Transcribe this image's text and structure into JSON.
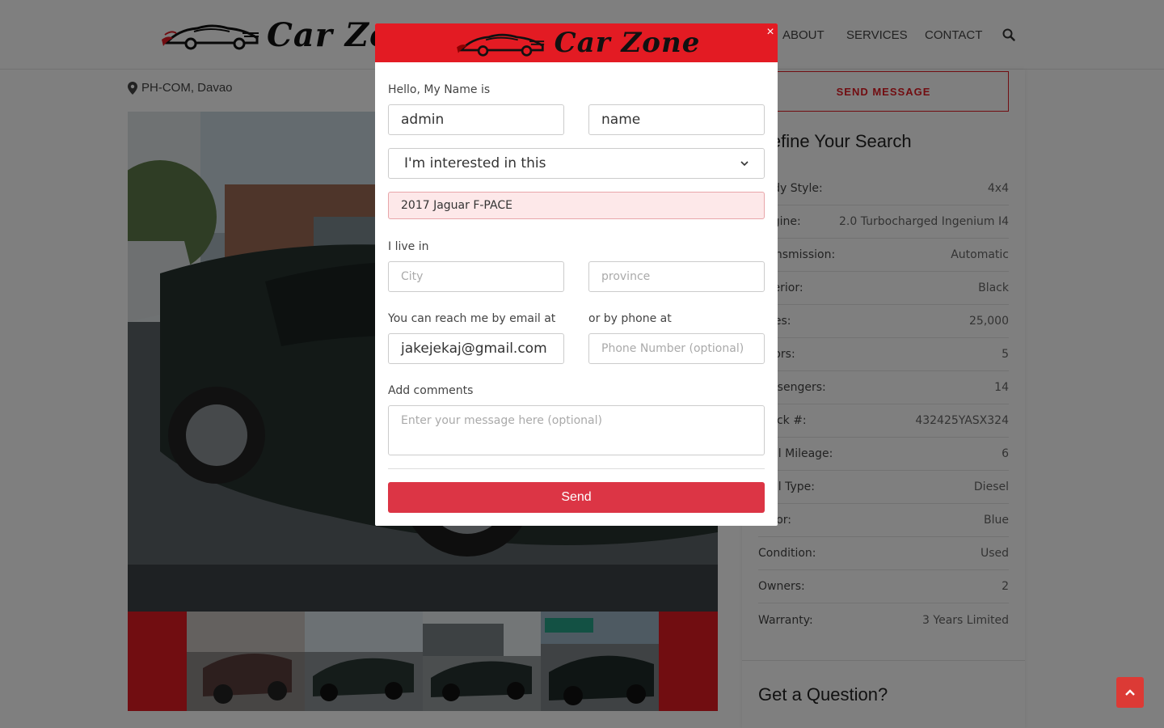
{
  "header": {
    "brand": "Car Zone",
    "nav": [
      {
        "label": "ABOUT"
      },
      {
        "label": "SERVICES"
      },
      {
        "label": "CONTACT"
      }
    ]
  },
  "listing": {
    "location": "PH-COM, Davao"
  },
  "sidebar": {
    "send_message": "SEND MESSAGE",
    "refine_title": "Refine Your Search",
    "specs": [
      {
        "label": "Body Style:",
        "value": "4x4"
      },
      {
        "label": "Engine:",
        "value": "2.0 Turbocharged Ingenium I4"
      },
      {
        "label": "Transmission:",
        "value": "Automatic"
      },
      {
        "label": "Interior:",
        "value": "Black"
      },
      {
        "label": "Miles:",
        "value": "25,000"
      },
      {
        "label": "Doors:",
        "value": "5"
      },
      {
        "label": "Passengers:",
        "value": "14"
      },
      {
        "label": "Stock #:",
        "value": "432425YASX324"
      },
      {
        "label": "Fuel Mileage:",
        "value": "6"
      },
      {
        "label": "Fuel Type:",
        "value": "Diesel"
      },
      {
        "label": "Color:",
        "value": "Blue"
      },
      {
        "label": "Condition:",
        "value": "Used"
      },
      {
        "label": "Owners:",
        "value": "2"
      },
      {
        "label": "Warranty:",
        "value": "3 Years Limited"
      }
    ],
    "question_title": "Get a Question?"
  },
  "modal": {
    "brand": "Car Zone",
    "close_label": "×",
    "name_label": "Hello, My Name is",
    "first_name_value": "admin",
    "last_name_value": "name",
    "interest_selected": "I'm interested in this",
    "vehicle": "2017 Jaguar F-PACE",
    "live_label": "I live in",
    "city_placeholder": "City",
    "province_placeholder": "province",
    "email_label": "You can reach me by email at",
    "email_value": "jakejekaj@gmail.com",
    "phone_label": "or by phone at",
    "phone_placeholder": "Phone Number (optional)",
    "comments_label": "Add comments",
    "comments_placeholder": "Enter your message here (optional)",
    "send_label": "Send"
  },
  "colors": {
    "brand_red": "#e31b23",
    "send_button": "#dc3545",
    "overlay": "rgba(0,0,0,0.5)"
  },
  "icons": [
    "location-pin-icon",
    "search-icon",
    "close-icon",
    "chevron-down-icon",
    "chevron-up-icon",
    "car-logo-icon"
  ]
}
